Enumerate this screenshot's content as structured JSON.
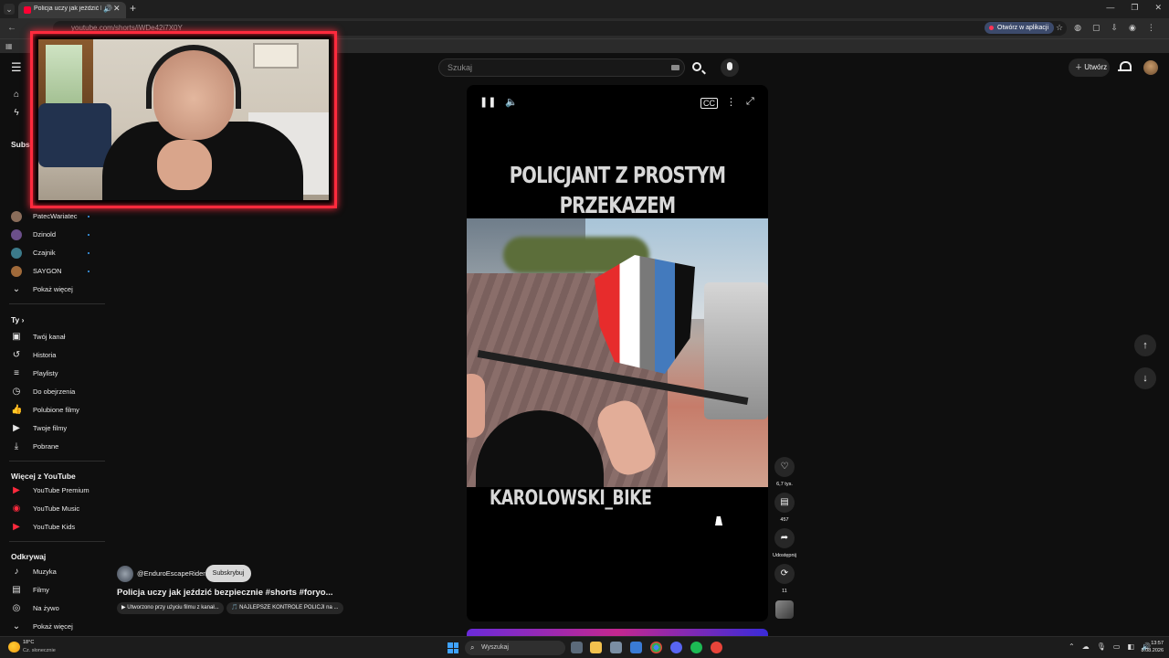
{
  "browser": {
    "tab_title": "Policja uczy jak jeździć bezp",
    "url": "youtube.com/shorts/iWDe42i7X0Y",
    "open_in_app": "Otwórz w aplikacji"
  },
  "header": {
    "search_placeholder": "Szukaj",
    "create_label": "Utwórz"
  },
  "sidebar": {
    "subscriptions_heading": "Subsk",
    "channels": [
      {
        "name": "PatecWariatec",
        "color": "#8a6d5a"
      },
      {
        "name": "Dzinold",
        "color": "#6b4f8a"
      },
      {
        "name": "Czajnik",
        "color": "#3c7a8a"
      },
      {
        "name": "SAYGON",
        "color": "#a06a3a"
      }
    ],
    "show_more_1": "Pokaż więcej",
    "you_heading": "Ty",
    "you_items": [
      {
        "label": "Twój kanał",
        "icon": "user-box-icon"
      },
      {
        "label": "Historia",
        "icon": "history-icon"
      },
      {
        "label": "Playlisty",
        "icon": "playlist-icon"
      },
      {
        "label": "Do obejrzenia",
        "icon": "clock-icon"
      },
      {
        "label": "Polubione filmy",
        "icon": "thumb-up-icon"
      },
      {
        "label": "Twoje filmy",
        "icon": "video-icon"
      },
      {
        "label": "Pobrane",
        "icon": "download-icon"
      }
    ],
    "more_heading": "Więcej z YouTube",
    "more_items": [
      {
        "label": "YouTube Premium"
      },
      {
        "label": "YouTube Music"
      },
      {
        "label": "YouTube Kids"
      }
    ],
    "explore_heading": "Odkrywaj",
    "explore_items": [
      {
        "label": "Muzyka",
        "icon": "music-icon"
      },
      {
        "label": "Filmy",
        "icon": "film-icon"
      },
      {
        "label": "Na żywo",
        "icon": "live-icon"
      }
    ],
    "show_more_2": "Pokaż więcej"
  },
  "short": {
    "overlay_title": "POLICJANT Z PROSTYM PRZEKAZEM",
    "overlay_handle": "KAROLOWSKI_BIKE",
    "likes": "6,7 tys.",
    "comments": "457",
    "share_label": "Udostępnij",
    "remix_count": "11",
    "channel_handle": "@EnduroEscapeRiders",
    "subscribe_label": "Subskrybuj",
    "title": "Policja uczy jak jeździć bezpiecznie #shorts #foryo...",
    "chip_1": "▶ Utworzono przy użyciu filmu z kanał...",
    "chip_2": "🎵 NAJLEPSZE KONTROLE POLICJI na ..."
  },
  "taskbar": {
    "temperature": "18°C",
    "weather": "Cz. słonecznie",
    "search_placeholder": "Wyszukaj",
    "time": "13:57",
    "date": "8.08.2026"
  }
}
